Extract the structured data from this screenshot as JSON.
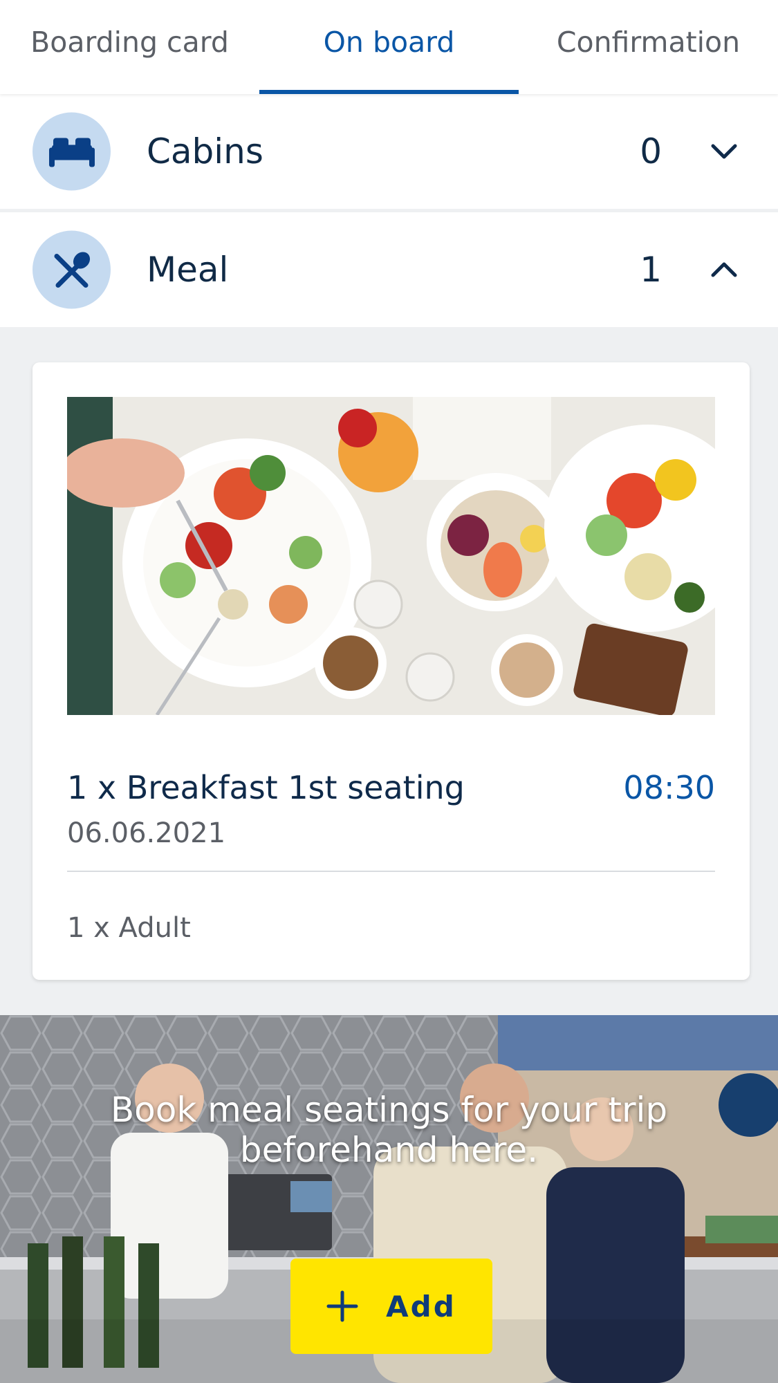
{
  "tabs": [
    {
      "label": "Boarding card",
      "active": false
    },
    {
      "label": "On board",
      "active": true
    },
    {
      "label": "Confirmation",
      "active": false
    }
  ],
  "sections": {
    "cabins": {
      "label": "Cabins",
      "count": "0",
      "icon": "bed-icon",
      "expanded": false
    },
    "meal": {
      "label": "Meal",
      "count": "1",
      "icon": "cutlery-icon",
      "expanded": true
    }
  },
  "meal_card": {
    "image": "breakfast-food-photo",
    "title": "1 x Breakfast 1st seating",
    "time": "08:30",
    "date": "06.06.2021",
    "passengers": "1 x Adult"
  },
  "banner": {
    "image": "restaurant-counter-photo",
    "text_line1": "Book meal seatings for your trip",
    "text_line2": "beforehand here.",
    "add_label": "Add"
  },
  "colors": {
    "accent": "#0a56a6",
    "text_dark": "#102a46",
    "icon_circle": "#c5daf0",
    "add_button": "#ffe500",
    "background": "#eef0f2"
  }
}
